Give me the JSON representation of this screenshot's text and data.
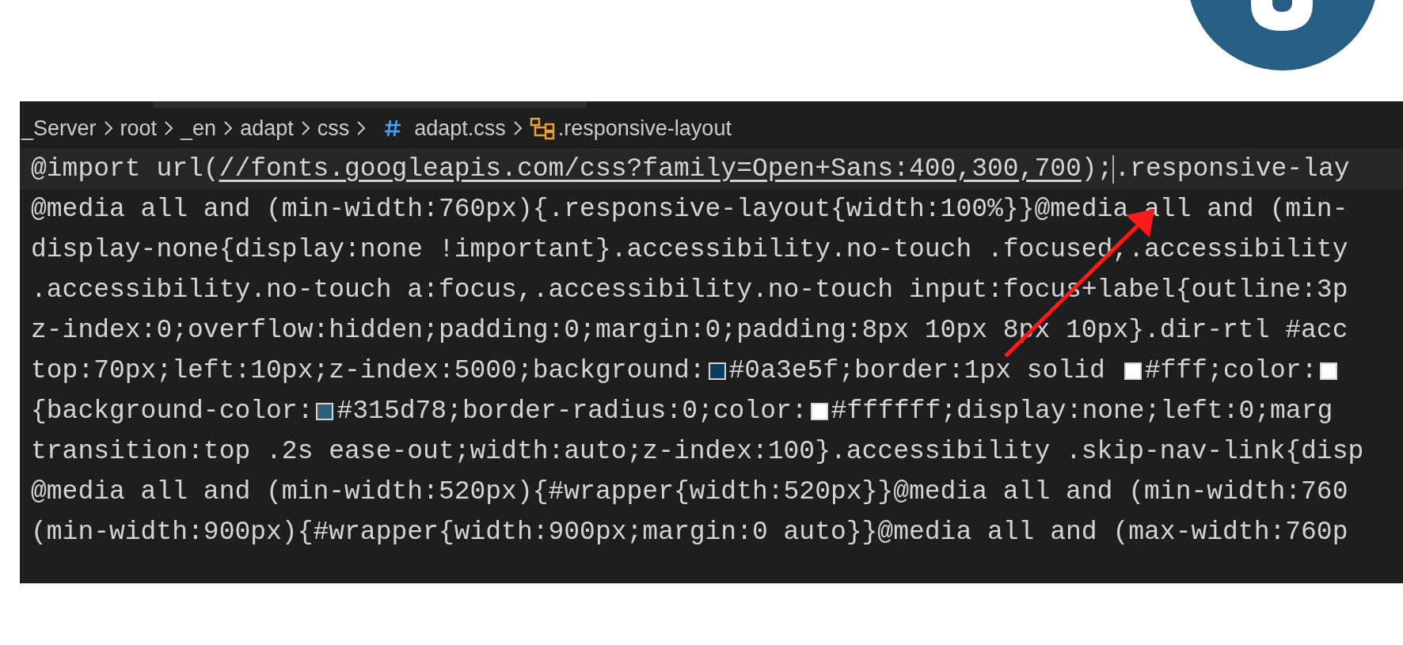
{
  "breadcrumb": [
    {
      "label": "_Server",
      "kind": "folder"
    },
    {
      "label": "root",
      "kind": "folder"
    },
    {
      "label": "_en",
      "kind": "folder"
    },
    {
      "label": "adapt",
      "kind": "folder"
    },
    {
      "label": "css",
      "kind": "folder"
    },
    {
      "label": "adapt.css",
      "kind": "file"
    },
    {
      "label": ".responsive-layout",
      "kind": "symbol"
    }
  ],
  "lines": [
    {
      "current": true,
      "segments": [
        {
          "kind": "text",
          "text": "@import url("
        },
        {
          "kind": "link",
          "text": "//fonts.googleapis.com/css?family=Open+Sans:400,300,700"
        },
        {
          "kind": "text",
          "text": ");"
        },
        {
          "kind": "cursor"
        },
        {
          "kind": "text",
          "text": ".responsive-lay"
        }
      ]
    },
    {
      "current": false,
      "segments": [
        {
          "kind": "text",
          "text": "@media all and (min-width:760px){.responsive-layout{width:100%}}@media all and (min-"
        }
      ]
    },
    {
      "current": false,
      "segments": [
        {
          "kind": "text",
          "text": "display-none{display:none !important}.accessibility.no-touch .focused,.accessibility"
        }
      ]
    },
    {
      "current": false,
      "segments": [
        {
          "kind": "text",
          "text": ".accessibility.no-touch a:focus,.accessibility.no-touch input:focus+label{outline:3p"
        }
      ]
    },
    {
      "current": false,
      "segments": [
        {
          "kind": "text",
          "text": "z-index:0;overflow:hidden;padding:0;margin:0;padding:8px 10px 8px 10px}.dir-rtl #acc"
        }
      ]
    },
    {
      "current": false,
      "segments": [
        {
          "kind": "text",
          "text": "top:70px;left:10px;z-index:5000;background:"
        },
        {
          "kind": "swatch",
          "color": "#0a3e5f"
        },
        {
          "kind": "text",
          "text": "#0a3e5f;border:1px solid "
        },
        {
          "kind": "swatch",
          "color": "#ffffff"
        },
        {
          "kind": "text",
          "text": "#fff;color:"
        },
        {
          "kind": "swatch",
          "color": "#ffffff"
        }
      ]
    },
    {
      "current": false,
      "segments": [
        {
          "kind": "text",
          "text": "{background-color:"
        },
        {
          "kind": "swatch",
          "color": "#315d78"
        },
        {
          "kind": "text",
          "text": "#315d78;border-radius:0;color:"
        },
        {
          "kind": "swatch",
          "color": "#ffffff"
        },
        {
          "kind": "text",
          "text": "#ffffff;display:none;left:0;marg"
        }
      ]
    },
    {
      "current": false,
      "segments": [
        {
          "kind": "text",
          "text": "transition:top .2s ease-out;width:auto;z-index:100}.accessibility .skip-nav-link{disp"
        }
      ]
    },
    {
      "current": false,
      "segments": [
        {
          "kind": "text",
          "text": "@media all and (min-width:520px){#wrapper{width:520px}}@media all and (min-width:760"
        }
      ]
    },
    {
      "current": false,
      "segments": [
        {
          "kind": "text",
          "text": "(min-width:900px){#wrapper{width:900px;margin:0 auto}}@media all and (max-width:760p"
        }
      ]
    }
  ]
}
